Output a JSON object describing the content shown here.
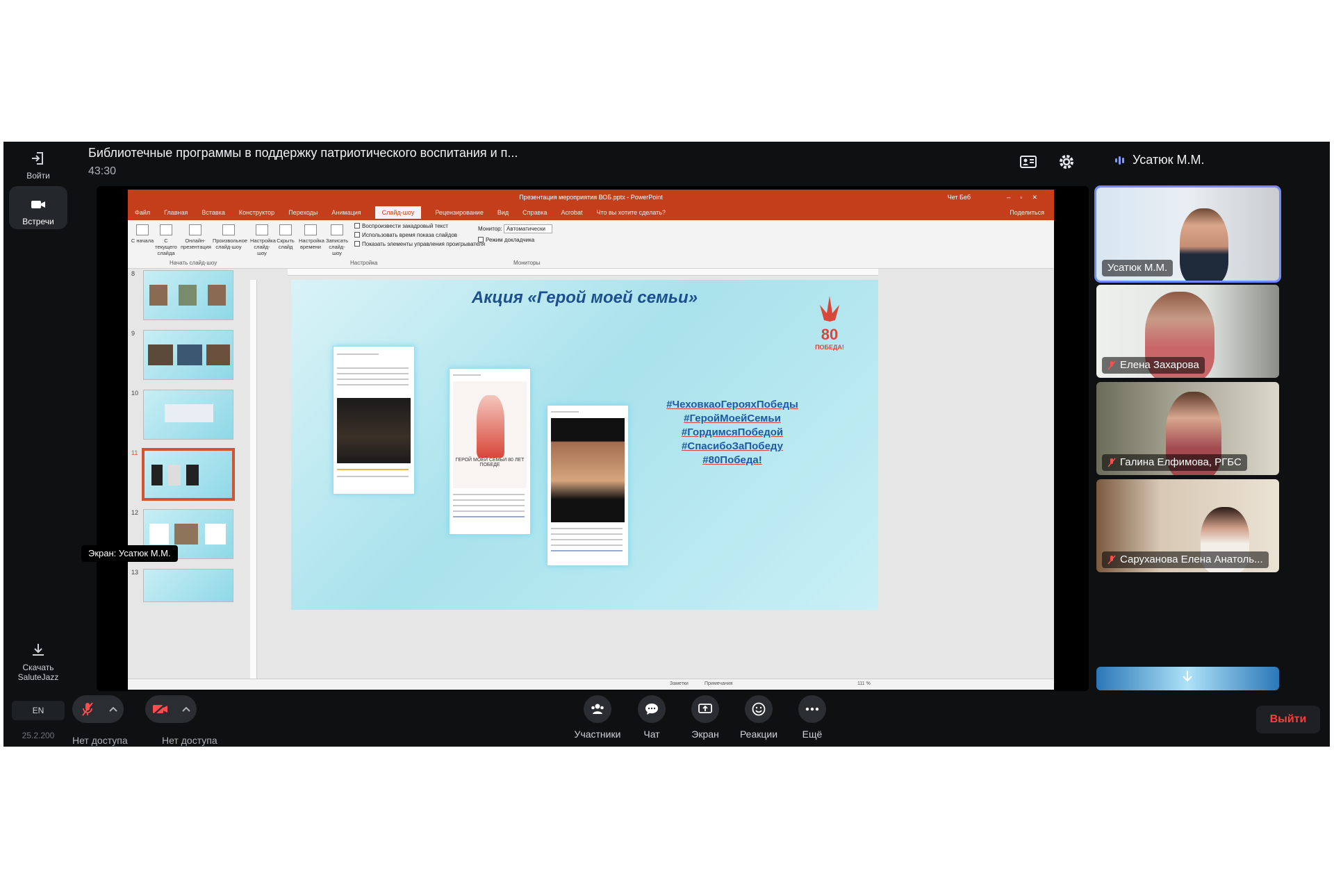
{
  "window": {
    "meeting_title": "Библиотечные программы в поддержку патриотического воспитания и п...",
    "timer": "43:30",
    "active_speaker": "Усатюк М.М."
  },
  "rail": {
    "login_label": "Войти",
    "meetings_label": "Встречи",
    "download_label_1": "Скачать",
    "download_label_2": "SaluteJazz",
    "lang": "EN",
    "version": "25.2.200"
  },
  "stage": {
    "screen_owner_label": "Экран: Усатюк М.М."
  },
  "ppt": {
    "window_title": "Презентация мероприятия ВОБ.pptx - PowerPoint",
    "user": "Чет Беб",
    "tabs": [
      "Файл",
      "Главная",
      "Вставка",
      "Конструктор",
      "Переходы",
      "Анимация",
      "Слайд-шоу",
      "Рецензирование",
      "Вид",
      "Справка",
      "Acrobat"
    ],
    "tell_me": "Что вы хотите сделать?",
    "share": "Поделиться",
    "ribbon": {
      "btn_from_start": "С начала",
      "btn_from_current": "С текущего слайда",
      "btn_online": "Онлайн-презентация",
      "btn_custom": "Произвольное слайд-шоу",
      "group_start": "Начать слайд-шоу",
      "btn_setup": "Настройка слайд-шоу",
      "btn_hide": "Скрыть слайд",
      "btn_rehearse": "Настройка времени",
      "btn_record": "Записать слайд-шоу",
      "chk_narration": "Воспроизвести закадровый текст",
      "chk_timings": "Использовать время показа слайдов",
      "chk_controls": "Показать элементы управления проигрывателя",
      "group_setup": "Настройка",
      "monitor_label": "Монитор:",
      "monitor_value": "Автоматически",
      "chk_presenter": "Режим докладчика",
      "group_monitors": "Мониторы"
    },
    "thumb_numbers": [
      "8",
      "9",
      "10",
      "11",
      "12",
      "13"
    ],
    "slide": {
      "title": "Акция «Герой моей семьи»",
      "hashtags": [
        "#ЧеховкаоГерояхПобеды",
        "#ГеройМоейСемьи",
        "#ГордимсяПобедой",
        "#СпасибоЗаПобеду",
        "#80Победа!"
      ],
      "logo_text": "80 ПОБЕДА!",
      "post_caption": "ГЕРОЙ МОЕЙ СЕМЬИ 80 ЛЕТ ПОБЕДЕ"
    },
    "status": {
      "notes": "Заметки",
      "comments": "Примечания",
      "zoom": "111 %"
    }
  },
  "participants": [
    {
      "name": "Усатюк М.М.",
      "muted": false
    },
    {
      "name": "Елена Захарова",
      "muted": true
    },
    {
      "name": "Галина Елфимова, РГБС",
      "muted": true
    },
    {
      "name": "Саруханова Елена Анатоль...",
      "muted": true
    }
  ],
  "controls": {
    "mic_label": "Нет доступа",
    "cam_label": "Нет доступа",
    "participants": "Участники",
    "chat": "Чат",
    "screen": "Экран",
    "reactions": "Реакции",
    "more": "Ещё",
    "exit": "Выйти"
  },
  "colors": {
    "ppt_accent": "#c43e1c",
    "exit_red": "#ff3b3b",
    "active_outline": "#6e8bff"
  }
}
